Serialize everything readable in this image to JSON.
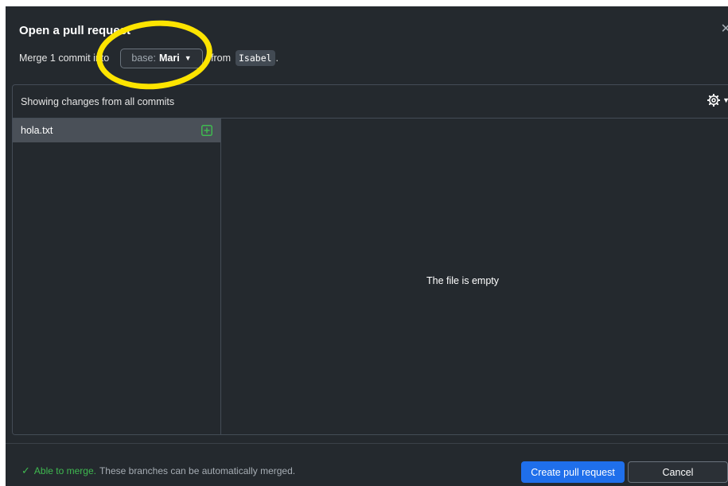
{
  "dialog": {
    "title": "Open a pull request",
    "close_icon": "close-icon",
    "merge_prefix": "Merge 1 commit into",
    "base_label": "base:",
    "base_branch": "Mari",
    "from_label": "from",
    "compare_branch": "Isabel",
    "period": "."
  },
  "annotation": {
    "highlight_color": "#fde400"
  },
  "diff": {
    "showing_text": "Showing changes from all commits",
    "settings_icon": "gear-icon",
    "files": [
      {
        "name": "hola.txt",
        "status_icon": "file-added-icon"
      }
    ],
    "empty_message": "The file is empty"
  },
  "footer": {
    "merge_ok": "Able to merge.",
    "merge_detail": "These branches can be automatically merged.",
    "create_label": "Create pull request",
    "cancel_label": "Cancel"
  },
  "colors": {
    "background": "#24292e",
    "accent": "#1f6feb",
    "success": "#3fb950"
  }
}
